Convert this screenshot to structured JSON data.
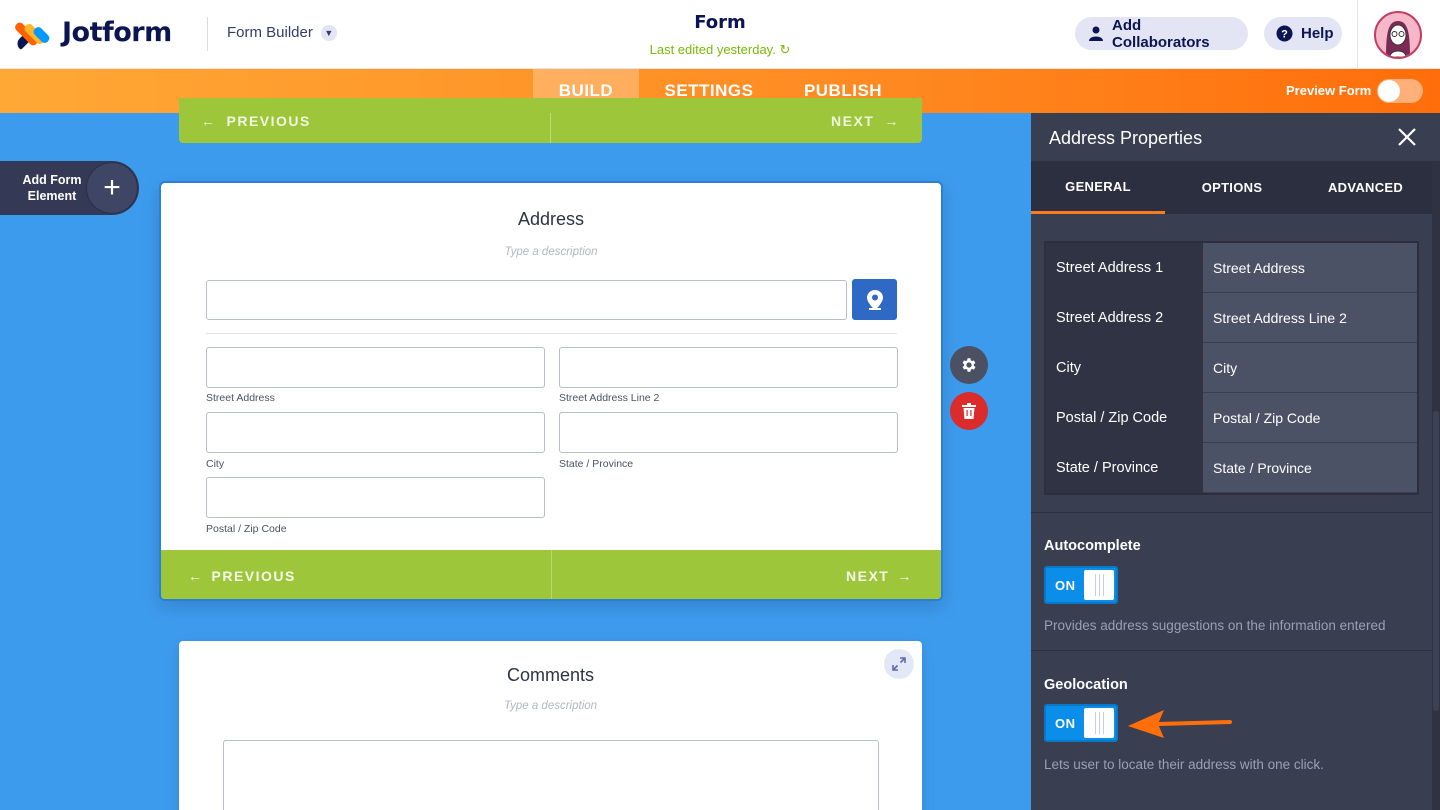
{
  "header": {
    "brand": "Jotform",
    "app_menu_label": "Form Builder",
    "form_title": "Form",
    "last_edited": "Last edited yesterday.",
    "add_collaborators": "Add Collaborators",
    "help": "Help"
  },
  "nav": {
    "tabs": [
      {
        "label": "BUILD",
        "active": true
      },
      {
        "label": "SETTINGS",
        "active": false
      },
      {
        "label": "PUBLISH",
        "active": false
      }
    ],
    "preview_label": "Preview Form"
  },
  "canvas": {
    "top_card": {
      "previous": "PREVIOUS",
      "next": "NEXT"
    },
    "add_element": {
      "line1": "Add Form",
      "line2": "Element"
    },
    "address": {
      "title": "Address",
      "description_placeholder": "Type a description",
      "sublabels": {
        "street1": "Street Address",
        "street2": "Street Address Line 2",
        "city": "City",
        "state": "State / Province",
        "postal": "Postal / Zip Code"
      },
      "previous": "PREVIOUS",
      "next": "NEXT"
    },
    "comments": {
      "title": "Comments",
      "description_placeholder": "Type a description"
    }
  },
  "panel": {
    "title": "Address Properties",
    "tabs": [
      {
        "label": "GENERAL",
        "active": true
      },
      {
        "label": "OPTIONS",
        "active": false
      },
      {
        "label": "ADVANCED",
        "active": false
      }
    ],
    "labels_table": [
      {
        "field": "Street Address 1",
        "value": "Street Address"
      },
      {
        "field": "Street Address 2",
        "value": "Street Address Line 2"
      },
      {
        "field": "City",
        "value": "City"
      },
      {
        "field": "Postal / Zip Code",
        "value": "Postal / Zip Code"
      },
      {
        "field": "State / Province",
        "value": "State / Province"
      }
    ],
    "autocomplete": {
      "label": "Autocomplete",
      "state": "ON",
      "help": "Provides address suggestions on the information entered"
    },
    "geolocation": {
      "label": "Geolocation",
      "state": "ON",
      "help": "Lets user to locate their address with one click."
    }
  },
  "colors": {
    "accent_orange": "#ff7b1c",
    "canvas_blue": "#3d9bee",
    "page_green": "#9dc63b",
    "toggle_blue": "#0a8ee9",
    "panel_bg": "#393e50"
  }
}
